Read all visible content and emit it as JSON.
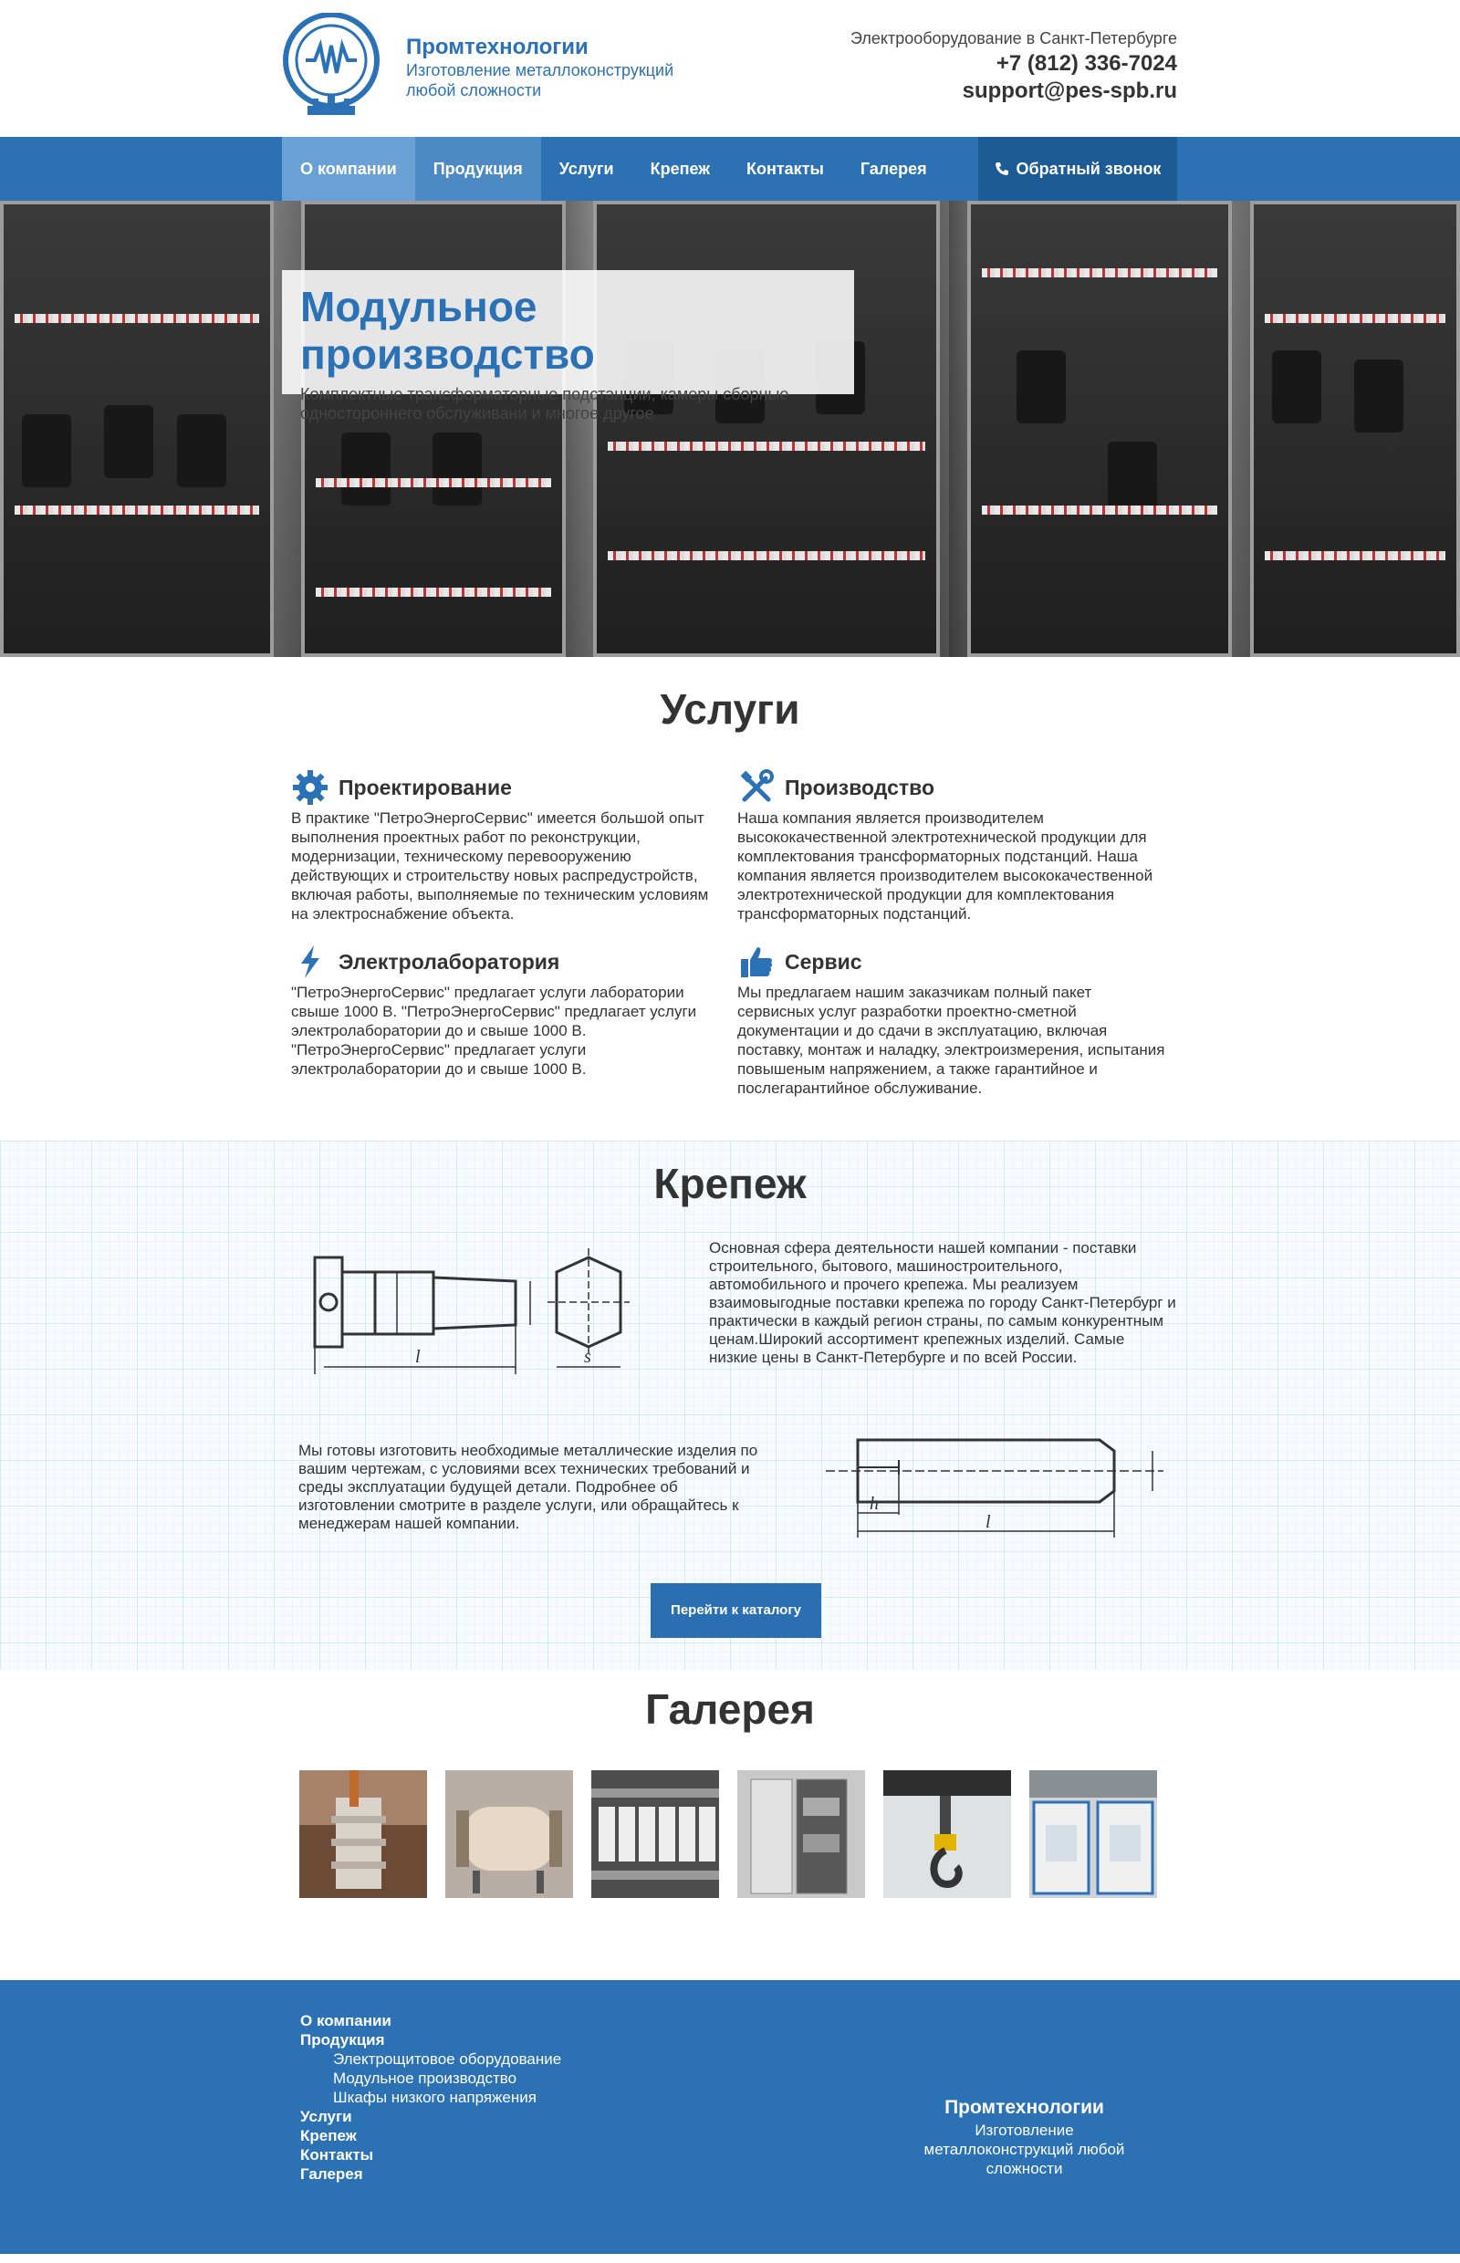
{
  "header": {
    "brand_name": "Промтехнологии",
    "brand_tagline": "Изготовление металлоконструкций любой сложности",
    "region": "Электрооборудование в Санкт-Петербурге",
    "phone": "+7 (812) 336-7024",
    "email": "support@pes-spb.ru"
  },
  "nav": {
    "items": [
      "О компании",
      "Продукция",
      "Услуги",
      "Крепеж",
      "Контакты",
      "Галерея"
    ],
    "callback_label": "Обратный звонок"
  },
  "hero": {
    "title": "Модульное производство",
    "subtitle": "Комплектные трансформаторные подстанции, камеры сборные одностороннего обслуживани и многое другое"
  },
  "services": {
    "title": "Услуги",
    "items": [
      {
        "icon": "gear-icon",
        "title": "Проектирование",
        "text": "В практике \"ПетроЭнергоСервис\" имеется большой опыт выполнения проектных работ по реконструкции, модернизации, техническому перевооружению действующих и строительству новых распредустройств, включая работы, выполняемые по техническим условиям на электроснабжение объекта."
      },
      {
        "icon": "tools-icon",
        "title": "Производство",
        "text": "Наша компания является производителем высококачественной электротехнической продукции для комплектования трансформаторных подстанций. Наша компания является производителем высококачественной электротехнической продукции для комплектования трансформаторных подстанций."
      },
      {
        "icon": "lightning-icon",
        "title": "Электролаборатория",
        "text": "\"ПетроЭнергоСервис\" предлагает услуги лаборатории свыше 1000 В. \"ПетроЭнергоСервис\" предлагает услуги электролаборатории до и свыше 1000 В. \"ПетроЭнергоСервис\" предлагает услуги электролаборатории до и свыше 1000 В."
      },
      {
        "icon": "thumbs-up-icon",
        "title": "Сервис",
        "text": "Мы предлагаем нашим заказчикам полный пакет сервисных услуг разработки проектно-сметной документации и до сдачи в эксплуатацию, включая поставку, монтаж и наладку, электроизмерения, испытания повышеным напряжением, а также гарантийное и послегарантийное обслуживание."
      }
    ]
  },
  "krepezh": {
    "title": "Крепеж",
    "text1": "Основная сфера деятельности нашей компании - поставки строительного, бытового, машиностроительного, автомобильного и прочего крепежа. Мы реализуем взаимовыгодные поставки крепежа по городу Санкт-Петербург и практически в каждый регион страны, по самым конкурентным ценам.Широкий ассортимент крепежных изделий. Самые низкие цены в Санкт-Петербурге и по всей России.",
    "text2": "Мы готовы изготовить необходимые металлические изделия по вашим чертежам, с условиями всех технических требований и среды эксплуатации будущей детали. Подробнее об изготовлении смотрите в разделе услуги, или обращайтесь к менеджерам нашей компании.",
    "drawing_labels": {
      "bolt_l": "l",
      "bolt_s": "s",
      "pin_h": "h",
      "pin_l": "l"
    },
    "button_label": "Перейти к каталогу"
  },
  "gallery": {
    "title": "Галерея",
    "items": [
      "insulator-photo",
      "tank-photo",
      "breakers-photo",
      "cabinet-photo",
      "hook-photo",
      "substation-photo"
    ]
  },
  "footer": {
    "menu": [
      {
        "label": "О компании",
        "children": []
      },
      {
        "label": "Продукция",
        "children": [
          "Электрощитовое оборудование",
          "Модульное производство",
          "Шкафы низкого напряжения"
        ]
      },
      {
        "label": "Услуги",
        "children": []
      },
      {
        "label": "Крепеж",
        "children": []
      },
      {
        "label": "Контакты",
        "children": []
      },
      {
        "label": "Галерея",
        "children": []
      }
    ],
    "brand_name": "Промтехнологии",
    "brand_tagline": "Изготовление металлоконструкций любой сложности"
  },
  "colors": {
    "accent": "#2b71b4",
    "accent_dark": "#1d5b96",
    "nav_active": "#6aa1d4"
  }
}
